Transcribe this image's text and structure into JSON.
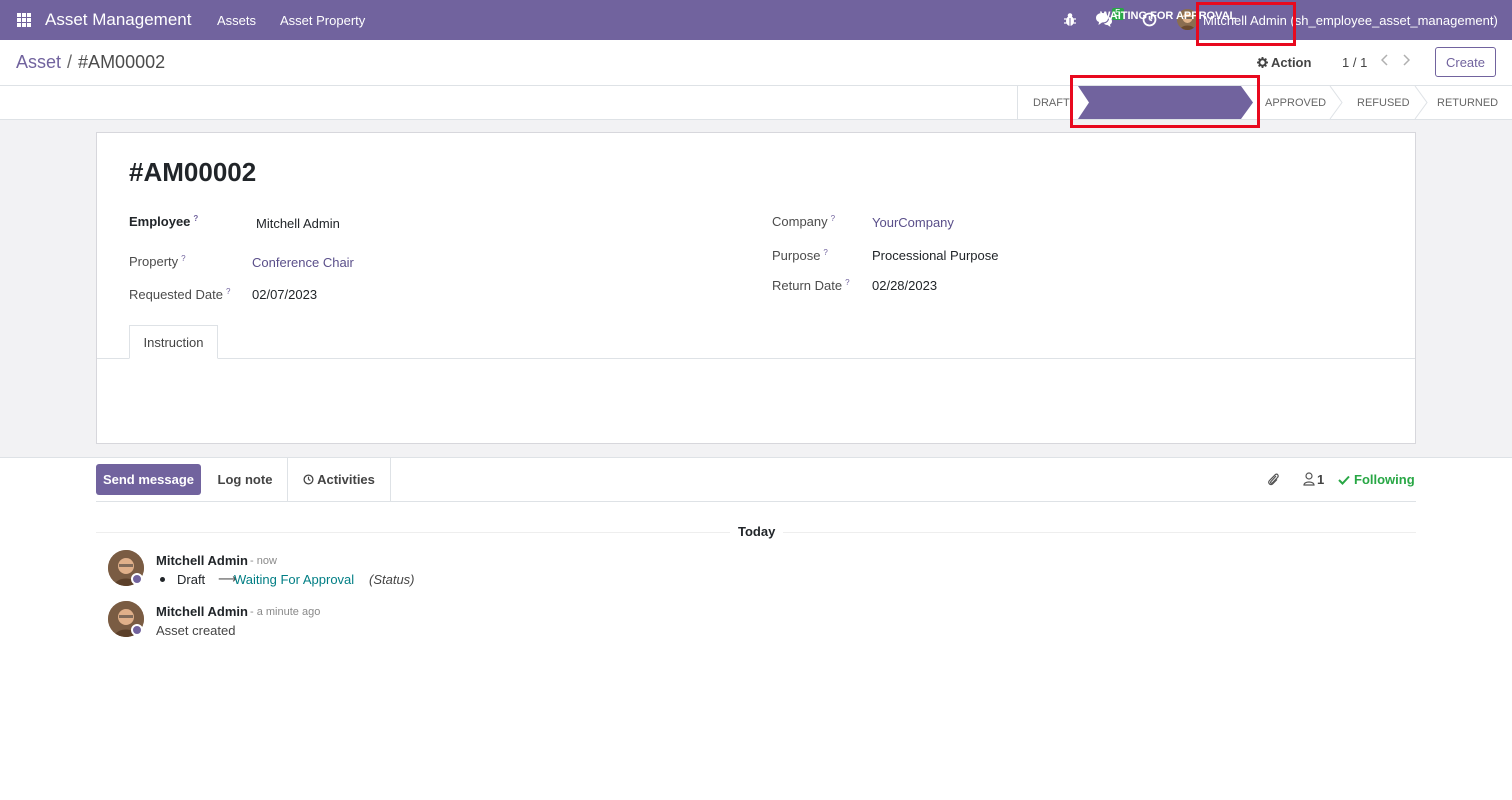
{
  "navbar": {
    "app_name": "Asset Management",
    "menus": [
      "Assets",
      "Asset Property"
    ],
    "chat_badge": "5",
    "user": "Mitchell Admin (sh_employee_asset_management)"
  },
  "control_panel": {
    "breadcrumb_parent": "Asset",
    "breadcrumb_sep": "/",
    "breadcrumb_current": "#AM00002",
    "action_label": "Action",
    "pager": "1 / 1",
    "create_label": "Create"
  },
  "statusbar": {
    "stages": [
      "DRAFT",
      "WAITING FOR APPROVAL",
      "APPROVED",
      "REFUSED",
      "RETURNED"
    ],
    "active_stage": "WAITING FOR APPROVAL",
    "active_color": "#71639e"
  },
  "form": {
    "title": "#AM00002",
    "employee_label": "Employee",
    "employee_value": "Mitchell Admin",
    "property_label": "Property",
    "property_value": "Conference Chair",
    "requested_date_label": "Requested Date",
    "requested_date_value": "02/07/2023",
    "company_label": "Company",
    "company_value": "YourCompany",
    "purpose_label": "Purpose",
    "purpose_value": "Processional Purpose",
    "return_date_label": "Return Date",
    "return_date_value": "02/28/2023",
    "help_mark": "?",
    "tab_label": "Instruction"
  },
  "chatter": {
    "send_message": "Send message",
    "log_note": "Log note",
    "activities": "Activities",
    "follower_count": "1",
    "following": "Following",
    "date_separator": "Today",
    "messages": [
      {
        "author": "Mitchell Admin",
        "time": "- now",
        "tracking_old": "Draft",
        "tracking_arrow": "⟶",
        "tracking_new": "Waiting For Approval",
        "tracking_field": "(Status)"
      },
      {
        "author": "Mitchell Admin",
        "time": "- a minute ago",
        "body": "Asset created"
      }
    ]
  },
  "colors": {
    "brand": "#71639e",
    "highlight_box": "#e8091e",
    "following": "#28a745",
    "tracking_link": "#017e84"
  }
}
